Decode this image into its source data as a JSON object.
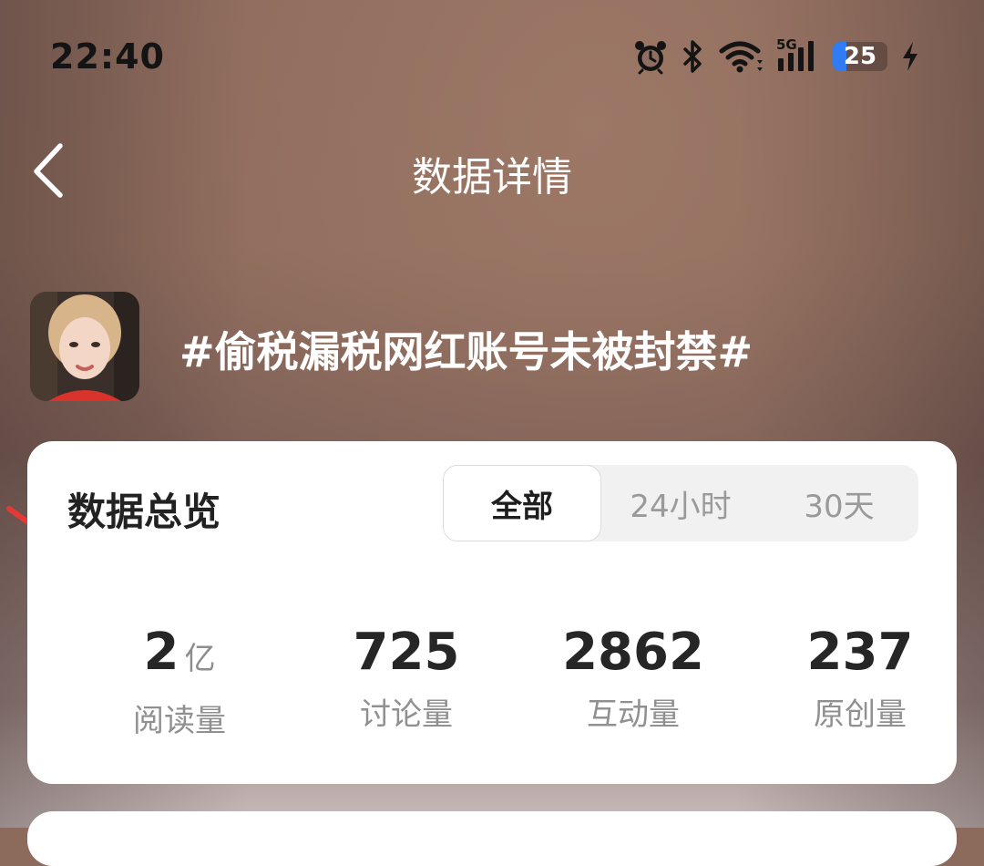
{
  "status_bar": {
    "time": "22:40",
    "network": "5G",
    "battery_level": "25",
    "battery_fraction": 0.25,
    "icons": [
      "alarm-icon",
      "bluetooth-icon",
      "wifi-icon",
      "cellular-signal-icon",
      "battery-icon",
      "charging-bolt-icon"
    ]
  },
  "nav": {
    "back_icon": "chevron-left-icon",
    "title": "数据详情"
  },
  "topic": {
    "title": "#偷税漏税网红账号未被封禁#"
  },
  "overview": {
    "title": "数据总览",
    "tabs": [
      {
        "label": "全部",
        "active": true
      },
      {
        "label": "24小时",
        "active": false
      },
      {
        "label": "30天",
        "active": false
      }
    ],
    "stats": [
      {
        "value": "2",
        "unit": "亿",
        "label": "阅读量"
      },
      {
        "value": "725",
        "unit": "",
        "label": "讨论量"
      },
      {
        "value": "2862",
        "unit": "",
        "label": "互动量"
      },
      {
        "value": "237",
        "unit": "",
        "label": "原创量"
      }
    ]
  },
  "colors": {
    "accent_battery": "#2f7cf6",
    "annotation_arrow": "#e53935",
    "card_bg": "#ffffff"
  }
}
